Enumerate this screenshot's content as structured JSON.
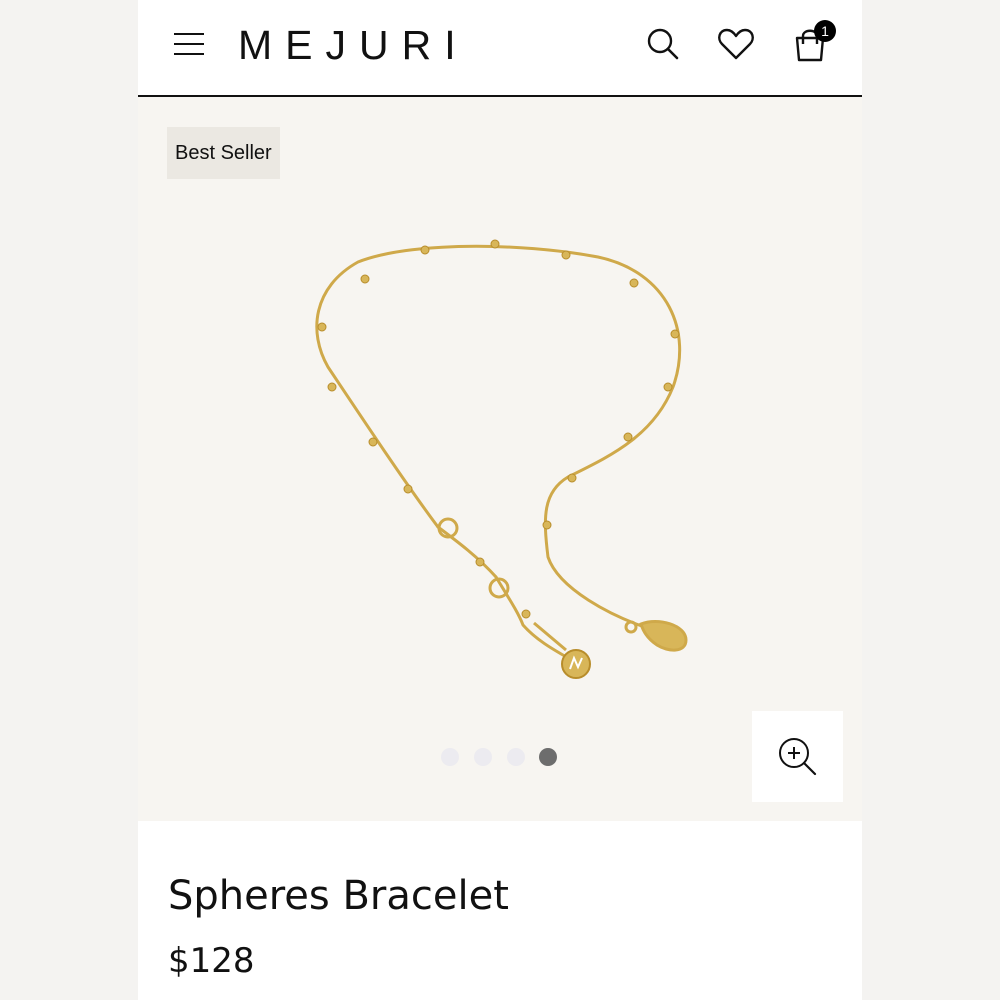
{
  "header": {
    "brand": "MEJURI",
    "menu_icon": "hamburger-menu-icon",
    "search_icon": "search-icon",
    "wishlist_icon": "heart-icon",
    "cart_icon": "shopping-bag-icon",
    "cart_count": "1"
  },
  "gallery": {
    "badge": "Best Seller",
    "image": "gold-spheres-bracelet-photo",
    "dots_total": 4,
    "active_dot": 4,
    "zoom_icon": "zoom-in-icon"
  },
  "product": {
    "name": "Spheres Bracelet",
    "price": "$128"
  },
  "colors": {
    "text": "#111111",
    "badge_bg": "#ebe8e2",
    "gallery_bg": "#f7f5f1",
    "gold": "#cfa94a",
    "dot_active": "#6d6d6d",
    "dot_inactive": "#ecebf0"
  }
}
